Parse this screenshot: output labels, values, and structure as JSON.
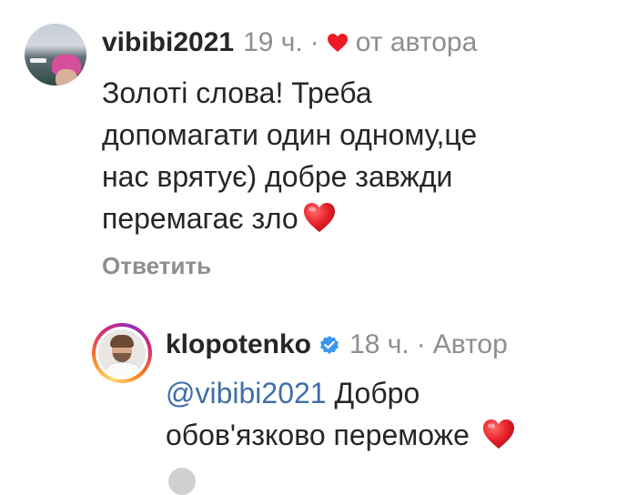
{
  "comment": {
    "username": "vibibi2021",
    "time": "19 ч.",
    "separator": "·",
    "liked_by_author": "от автора",
    "lines": [
      "Золоті слова! Треба",
      "допомагати один одному,це",
      "нас врятує) добре завжди",
      "перемагає зло"
    ],
    "reply_label": "Ответить"
  },
  "reply": {
    "username": "klopotenko",
    "time": "18 ч.",
    "separator": "·",
    "author_label": "Автор",
    "mention": "@vibibi2021",
    "line1_rest": " Добро",
    "line2": "обов'язково переможе "
  },
  "colors": {
    "heart": "#ed1c24",
    "verified": "#3897f0",
    "mention": "#3f6ea8",
    "muted": "#8e8e8e",
    "text": "#262626"
  },
  "icons": {
    "heart": "heart-icon",
    "verified": "verified-badge-icon"
  }
}
